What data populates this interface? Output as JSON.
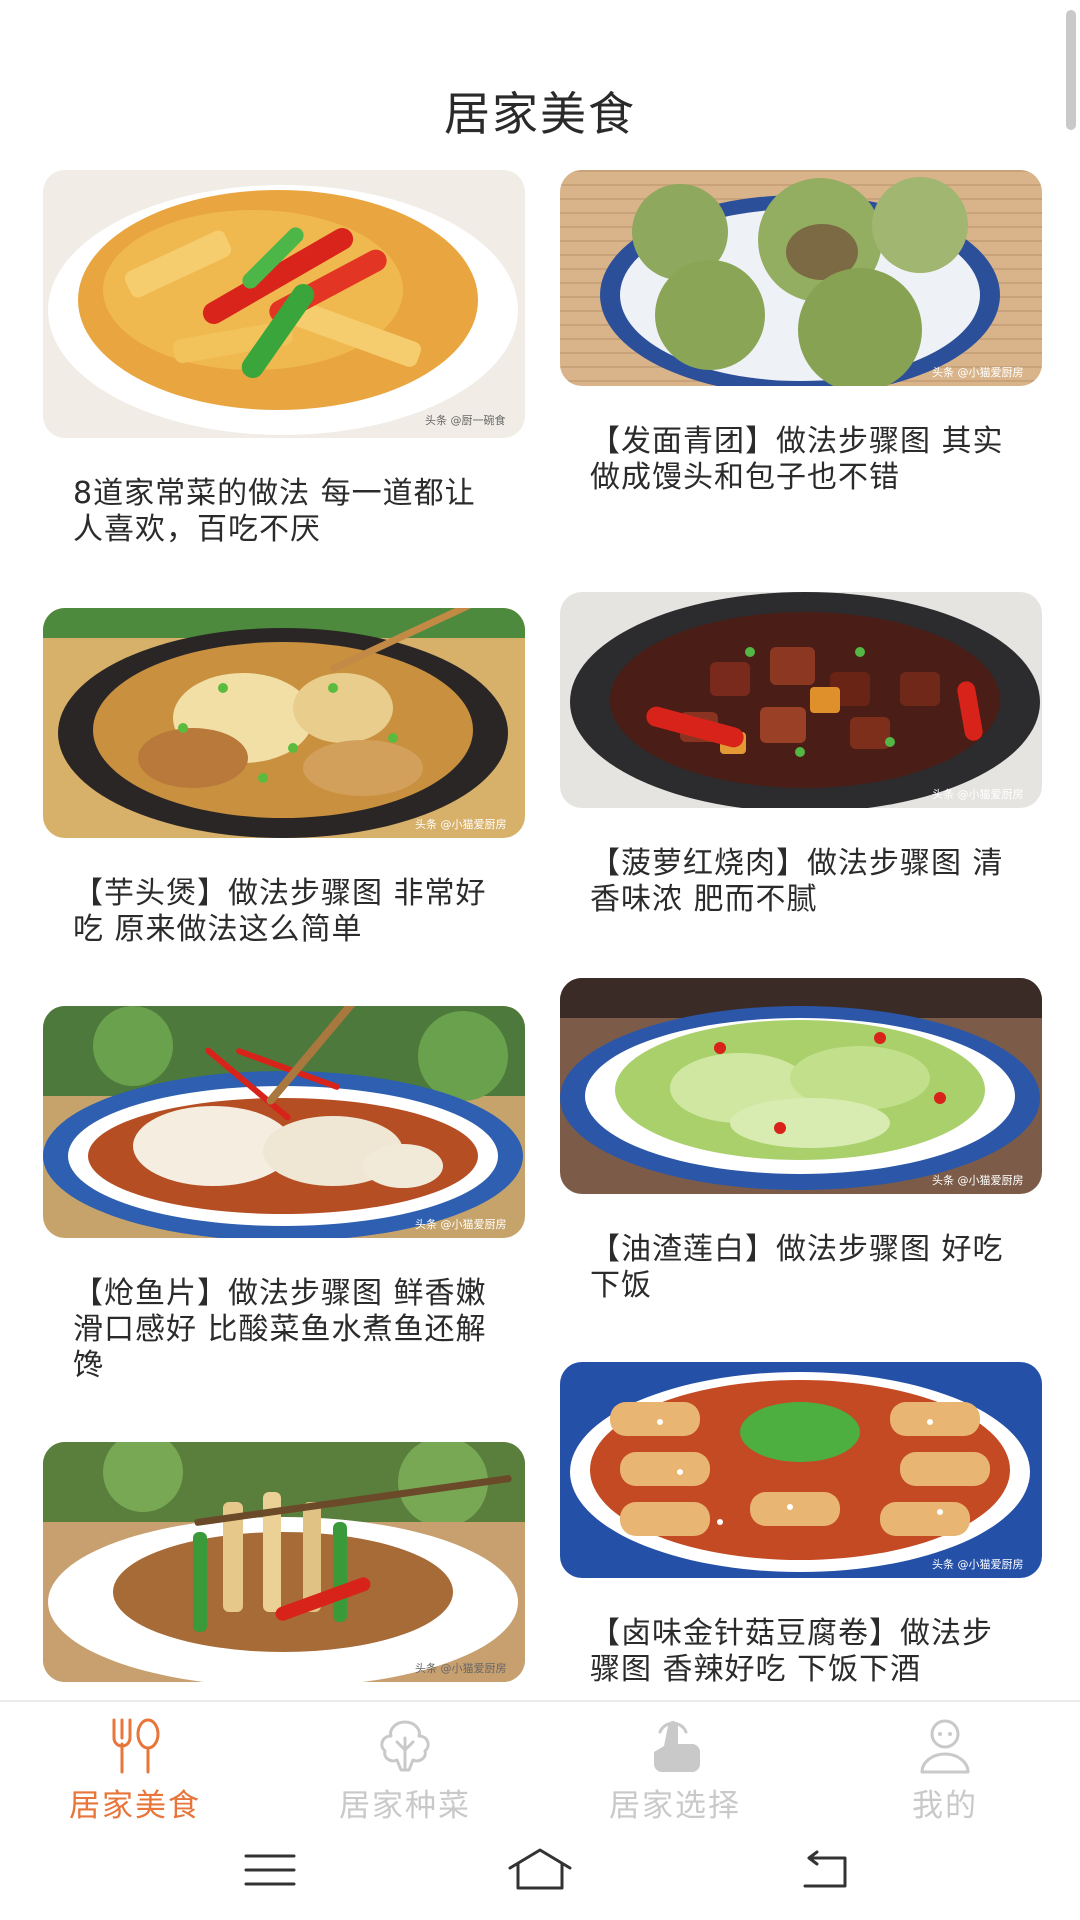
{
  "header": {
    "title": "居家美食"
  },
  "cards": [
    {
      "caption": "8道家常菜的做法 每一道都让人喜欢，百吃不厌",
      "watermark": "头条 @厨一碗食"
    },
    {
      "caption": "【发面青团】做法步骤图 其实做成馒头和包子也不错",
      "watermark": "头条 @小猫爱厨房"
    },
    {
      "caption": "【芋头煲】做法步骤图 非常好吃 原来做法这么简单",
      "watermark": "头条 @小猫爱厨房"
    },
    {
      "caption": "【菠萝红烧肉】做法步骤图 清香味浓 肥而不腻",
      "watermark": "头条 @小猫爱厨房"
    },
    {
      "caption": "【炝鱼片】做法步骤图 鲜香嫩滑口感好 比酸菜鱼水煮鱼还解馋",
      "watermark": "头条 @小猫爱厨房"
    },
    {
      "caption": "【油渣莲白】做法步骤图 好吃下饭",
      "watermark": "头条 @小猫爱厨房"
    },
    {
      "caption": "",
      "watermark": "头条 @小猫爱厨房"
    },
    {
      "caption": "【卤味金针菇豆腐卷】做法步骤图 香辣好吃 下饭下酒",
      "watermark": "头条 @小猫爱厨房"
    }
  ],
  "tabbar": {
    "items": [
      {
        "label": "居家美食",
        "icon": "fork-spoon-icon",
        "active": true
      },
      {
        "label": "居家种菜",
        "icon": "cabbage-icon",
        "active": false
      },
      {
        "label": "居家选择",
        "icon": "hand-tap-icon",
        "active": false
      },
      {
        "label": "我的",
        "icon": "user-icon",
        "active": false
      }
    ]
  },
  "colors": {
    "accent": "#e8753a",
    "inactive": "#c9c9c9"
  },
  "system_nav": {
    "icons": [
      "menu-icon",
      "home-icon",
      "back-icon"
    ]
  }
}
